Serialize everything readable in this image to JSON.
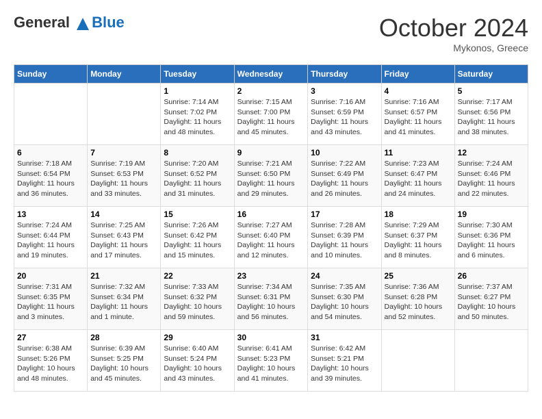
{
  "header": {
    "logo_line1": "General",
    "logo_line2": "Blue",
    "month": "October 2024",
    "location": "Mykonos, Greece"
  },
  "days_of_week": [
    "Sunday",
    "Monday",
    "Tuesday",
    "Wednesday",
    "Thursday",
    "Friday",
    "Saturday"
  ],
  "weeks": [
    [
      {
        "day": "",
        "info": ""
      },
      {
        "day": "",
        "info": ""
      },
      {
        "day": "1",
        "info": "Sunrise: 7:14 AM\nSunset: 7:02 PM\nDaylight: 11 hours and 48 minutes."
      },
      {
        "day": "2",
        "info": "Sunrise: 7:15 AM\nSunset: 7:00 PM\nDaylight: 11 hours and 45 minutes."
      },
      {
        "day": "3",
        "info": "Sunrise: 7:16 AM\nSunset: 6:59 PM\nDaylight: 11 hours and 43 minutes."
      },
      {
        "day": "4",
        "info": "Sunrise: 7:16 AM\nSunset: 6:57 PM\nDaylight: 11 hours and 41 minutes."
      },
      {
        "day": "5",
        "info": "Sunrise: 7:17 AM\nSunset: 6:56 PM\nDaylight: 11 hours and 38 minutes."
      }
    ],
    [
      {
        "day": "6",
        "info": "Sunrise: 7:18 AM\nSunset: 6:54 PM\nDaylight: 11 hours and 36 minutes."
      },
      {
        "day": "7",
        "info": "Sunrise: 7:19 AM\nSunset: 6:53 PM\nDaylight: 11 hours and 33 minutes."
      },
      {
        "day": "8",
        "info": "Sunrise: 7:20 AM\nSunset: 6:52 PM\nDaylight: 11 hours and 31 minutes."
      },
      {
        "day": "9",
        "info": "Sunrise: 7:21 AM\nSunset: 6:50 PM\nDaylight: 11 hours and 29 minutes."
      },
      {
        "day": "10",
        "info": "Sunrise: 7:22 AM\nSunset: 6:49 PM\nDaylight: 11 hours and 26 minutes."
      },
      {
        "day": "11",
        "info": "Sunrise: 7:23 AM\nSunset: 6:47 PM\nDaylight: 11 hours and 24 minutes."
      },
      {
        "day": "12",
        "info": "Sunrise: 7:24 AM\nSunset: 6:46 PM\nDaylight: 11 hours and 22 minutes."
      }
    ],
    [
      {
        "day": "13",
        "info": "Sunrise: 7:24 AM\nSunset: 6:44 PM\nDaylight: 11 hours and 19 minutes."
      },
      {
        "day": "14",
        "info": "Sunrise: 7:25 AM\nSunset: 6:43 PM\nDaylight: 11 hours and 17 minutes."
      },
      {
        "day": "15",
        "info": "Sunrise: 7:26 AM\nSunset: 6:42 PM\nDaylight: 11 hours and 15 minutes."
      },
      {
        "day": "16",
        "info": "Sunrise: 7:27 AM\nSunset: 6:40 PM\nDaylight: 11 hours and 12 minutes."
      },
      {
        "day": "17",
        "info": "Sunrise: 7:28 AM\nSunset: 6:39 PM\nDaylight: 11 hours and 10 minutes."
      },
      {
        "day": "18",
        "info": "Sunrise: 7:29 AM\nSunset: 6:37 PM\nDaylight: 11 hours and 8 minutes."
      },
      {
        "day": "19",
        "info": "Sunrise: 7:30 AM\nSunset: 6:36 PM\nDaylight: 11 hours and 6 minutes."
      }
    ],
    [
      {
        "day": "20",
        "info": "Sunrise: 7:31 AM\nSunset: 6:35 PM\nDaylight: 11 hours and 3 minutes."
      },
      {
        "day": "21",
        "info": "Sunrise: 7:32 AM\nSunset: 6:34 PM\nDaylight: 11 hours and 1 minute."
      },
      {
        "day": "22",
        "info": "Sunrise: 7:33 AM\nSunset: 6:32 PM\nDaylight: 10 hours and 59 minutes."
      },
      {
        "day": "23",
        "info": "Sunrise: 7:34 AM\nSunset: 6:31 PM\nDaylight: 10 hours and 56 minutes."
      },
      {
        "day": "24",
        "info": "Sunrise: 7:35 AM\nSunset: 6:30 PM\nDaylight: 10 hours and 54 minutes."
      },
      {
        "day": "25",
        "info": "Sunrise: 7:36 AM\nSunset: 6:28 PM\nDaylight: 10 hours and 52 minutes."
      },
      {
        "day": "26",
        "info": "Sunrise: 7:37 AM\nSunset: 6:27 PM\nDaylight: 10 hours and 50 minutes."
      }
    ],
    [
      {
        "day": "27",
        "info": "Sunrise: 6:38 AM\nSunset: 5:26 PM\nDaylight: 10 hours and 48 minutes."
      },
      {
        "day": "28",
        "info": "Sunrise: 6:39 AM\nSunset: 5:25 PM\nDaylight: 10 hours and 45 minutes."
      },
      {
        "day": "29",
        "info": "Sunrise: 6:40 AM\nSunset: 5:24 PM\nDaylight: 10 hours and 43 minutes."
      },
      {
        "day": "30",
        "info": "Sunrise: 6:41 AM\nSunset: 5:23 PM\nDaylight: 10 hours and 41 minutes."
      },
      {
        "day": "31",
        "info": "Sunrise: 6:42 AM\nSunset: 5:21 PM\nDaylight: 10 hours and 39 minutes."
      },
      {
        "day": "",
        "info": ""
      },
      {
        "day": "",
        "info": ""
      }
    ]
  ]
}
